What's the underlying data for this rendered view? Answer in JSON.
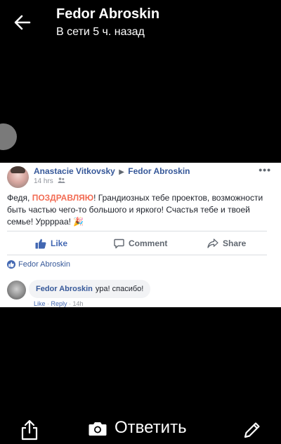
{
  "header": {
    "title": "Fedor Abroskin",
    "subtitle": "В сети 5 ч. назад"
  },
  "post": {
    "author": "Anastacie Vitkovsky",
    "recipient": "Fedor Abroskin",
    "time": "14 hrs",
    "more": "•••",
    "text_before": "Федя, ",
    "text_highlight": "ПОЗДРАВЛЯЮ",
    "text_after": "! Грандиозных тебе проектов, возможности быть частью чего-то большого и яркого! Счастья тебе и твоей семье! Урррраа! 🎉",
    "actions": {
      "like": "Like",
      "comment": "Comment",
      "share": "Share"
    },
    "liked_by": "Fedor Abroskin",
    "comment": {
      "author": "Fedor Abroskin",
      "text": "ура! спасибо!",
      "like": "Like",
      "sep": " · ",
      "reply": "Reply",
      "time": "14h"
    }
  },
  "bottom": {
    "reply_label": "Ответить"
  },
  "colors": {
    "fb_blue": "#4267b2",
    "name_blue": "#365899",
    "highlight": "#f26c54"
  },
  "icons": [
    "back-arrow-icon",
    "friends-icon",
    "like-icon",
    "comment-icon",
    "share-icon",
    "share-upload-icon",
    "camera-icon",
    "pencil-icon"
  ]
}
